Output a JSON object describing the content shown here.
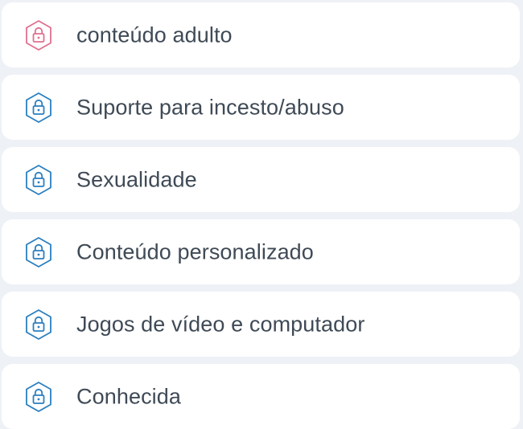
{
  "colors": {
    "accent_pink": "#e0708f",
    "accent_blue": "#2a7fc0",
    "text": "#3f4a56",
    "card_bg": "#ffffff",
    "page_bg": "#eef1f6"
  },
  "items": [
    {
      "label": "conteúdo adulto",
      "icon": "lock-icon",
      "icon_color": "#e0708f"
    },
    {
      "label": "Suporte para incesto/abuso",
      "icon": "lock-icon",
      "icon_color": "#2a7fc0"
    },
    {
      "label": "Sexualidade",
      "icon": "lock-icon",
      "icon_color": "#2a7fc0"
    },
    {
      "label": "Conteúdo personalizado",
      "icon": "lock-icon",
      "icon_color": "#2a7fc0"
    },
    {
      "label": "Jogos de vídeo e computador",
      "icon": "lock-icon",
      "icon_color": "#2a7fc0"
    },
    {
      "label": "Conhecida",
      "icon": "lock-icon",
      "icon_color": "#2a7fc0"
    }
  ]
}
